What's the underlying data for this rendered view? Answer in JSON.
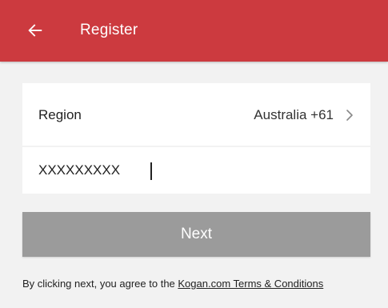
{
  "app_bar": {
    "title": "Register",
    "back_icon": "arrow-left-icon",
    "background_color": "#cc3a3f"
  },
  "region": {
    "label": "Region",
    "value": "Australia +61",
    "chevron_icon": "chevron-right-icon"
  },
  "phone": {
    "value": "XXXXXXXXX"
  },
  "next_button": {
    "label": "Next",
    "state": "disabled",
    "color": "#9b9b9b"
  },
  "terms": {
    "prefix": "By clicking next, you agree to the ",
    "link_text": "Kogan.com Terms & Conditions"
  }
}
